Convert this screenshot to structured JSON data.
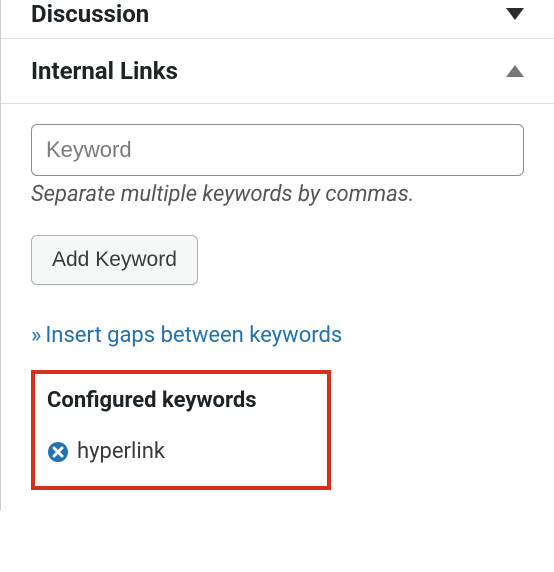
{
  "sections": {
    "discussion": {
      "title": "Discussion"
    },
    "internal_links": {
      "title": "Internal Links"
    }
  },
  "keyword_input": {
    "placeholder": "Keyword",
    "value": ""
  },
  "help_text": "Separate multiple keywords by commas.",
  "buttons": {
    "add_keyword": "Add Keyword"
  },
  "links": {
    "insert_gaps_prefix": "»",
    "insert_gaps": "Insert gaps between keywords"
  },
  "configured": {
    "title": "Configured keywords",
    "items": [
      {
        "label": "hyperlink"
      }
    ]
  }
}
